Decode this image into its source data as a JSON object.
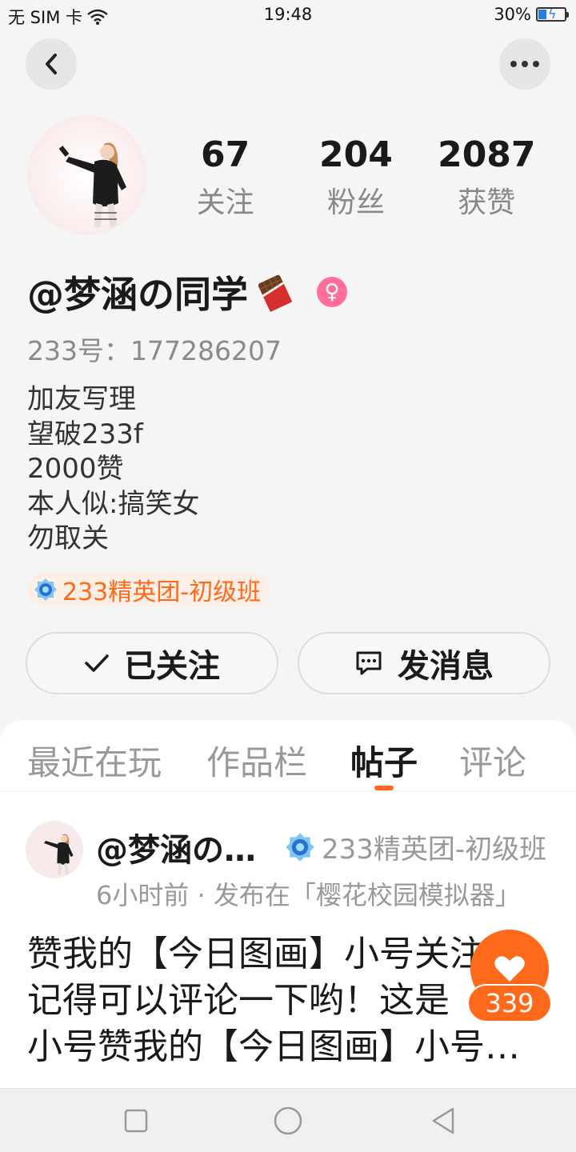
{
  "status_bar": {
    "carrier": "无 SIM 卡",
    "time": "19:48",
    "battery": "30%"
  },
  "profile": {
    "stats": [
      {
        "value": "67",
        "label": "关注"
      },
      {
        "value": "204",
        "label": "粉丝"
      },
      {
        "value": "2087",
        "label": "获赞"
      }
    ],
    "username": "@梦涵の同学",
    "user_id": "233号：177286207",
    "bio": [
      "加友写理",
      "望破233f",
      "2000赞",
      "本人似:搞笑女",
      "勿取关"
    ],
    "badge": "233精英团-初级班",
    "follow_label": "已关注",
    "message_label": "发消息"
  },
  "tabs": [
    {
      "label": "最近在玩"
    },
    {
      "label": "作品栏"
    },
    {
      "label": "帖子"
    },
    {
      "label": "评论"
    }
  ],
  "post": {
    "author": "@梦涵の…",
    "badge": "233精英团-初级班",
    "meta": "6小时前 · 发布在「樱花校园模拟器」",
    "lines": [
      "赞我的【今日图画】小号关注",
      "记得可以评论一下哟！这是",
      "小号赞我的【今日图画】小号…"
    ],
    "like_count": "339"
  },
  "colors": {
    "accent": "#ff6a1a",
    "gender": "#ff6f9a"
  }
}
